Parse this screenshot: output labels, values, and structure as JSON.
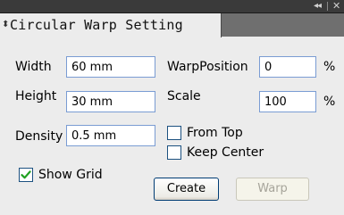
{
  "titlebar": {
    "collapse_glyph": "◂◂",
    "close_glyph": "✕"
  },
  "panel": {
    "tab_title": "Circular Warp Setting",
    "tab_arrow_icon": "double-arrow-icon",
    "tab_arrow_glyph": "⬍"
  },
  "form": {
    "width": {
      "label": "Width",
      "value": "60 mm"
    },
    "height": {
      "label": "Height",
      "value": "30 mm"
    },
    "density": {
      "label": "Density",
      "value": "0.5 mm"
    },
    "warp_position": {
      "label": "WarpPosition",
      "value": "0",
      "unit": "%"
    },
    "scale": {
      "label": "Scale",
      "value": "100",
      "unit": "%"
    },
    "from_top": {
      "label": "From Top",
      "checked": false
    },
    "keep_center": {
      "label": "Keep Center",
      "checked": false
    },
    "show_grid": {
      "label": "Show Grid",
      "checked": true
    }
  },
  "buttons": {
    "create": "Create",
    "warp": "Warp"
  },
  "colors": {
    "titlebar": "#3a3a3a",
    "tabstrip": "#6f6f6f",
    "panel_bg": "#ececec",
    "field_border": "#7a9cd3",
    "check_mark": "#21a121",
    "disabled_text": "#a6a49a"
  }
}
